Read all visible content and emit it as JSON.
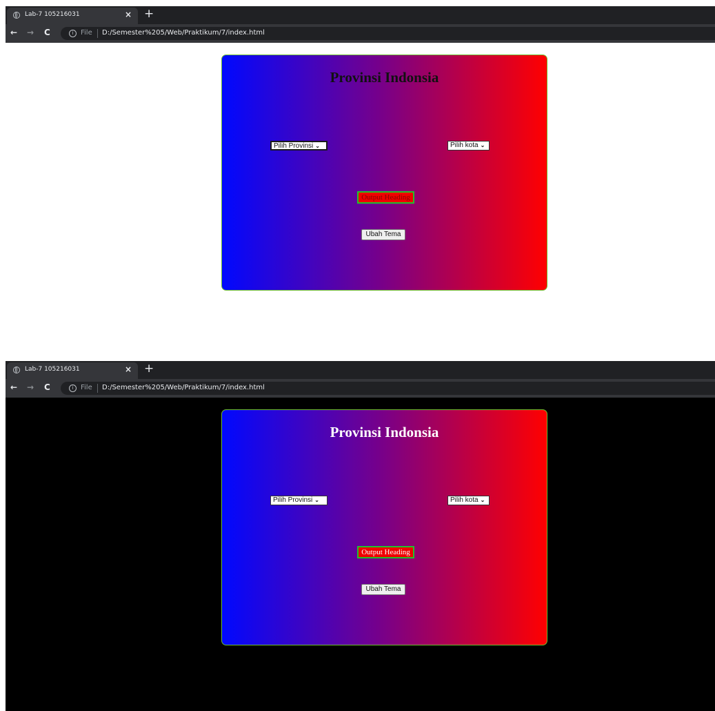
{
  "browser": {
    "tab_title": "Lab-7 105216031",
    "tab_close": "×",
    "new_tab": "+",
    "back": "←",
    "forward": "→",
    "reload": "C",
    "info_symbol": "i",
    "origin_label": "File",
    "url": "D:/Semester%205/Web/Praktikum/7/index.html"
  },
  "page": {
    "heading": "Provinsi Indonsia",
    "province_select": {
      "selected": "Pilih Provinsi"
    },
    "city_select": {
      "selected": "Pilih kota"
    },
    "output_heading": "Output Heading",
    "theme_button": "Ubah Tema"
  },
  "themes": {
    "light": {
      "page_background": "#ffffff",
      "heading_color": "#111111",
      "output_text_color": "#8a0000"
    },
    "dark": {
      "page_background": "#000000",
      "heading_color": "#ffffff",
      "output_text_color": "#ffffff"
    }
  },
  "colors": {
    "card_gradient": [
      "#0008ff",
      "#7a0087",
      "#ff0000"
    ],
    "card_border": "#6ebd2f",
    "output_background": "#ef0000",
    "output_border": "#21c22c"
  },
  "icons": {
    "tab_favicon": "globe-icon",
    "site_info": "info-icon",
    "select_chevron": "chevron-down-icon"
  }
}
